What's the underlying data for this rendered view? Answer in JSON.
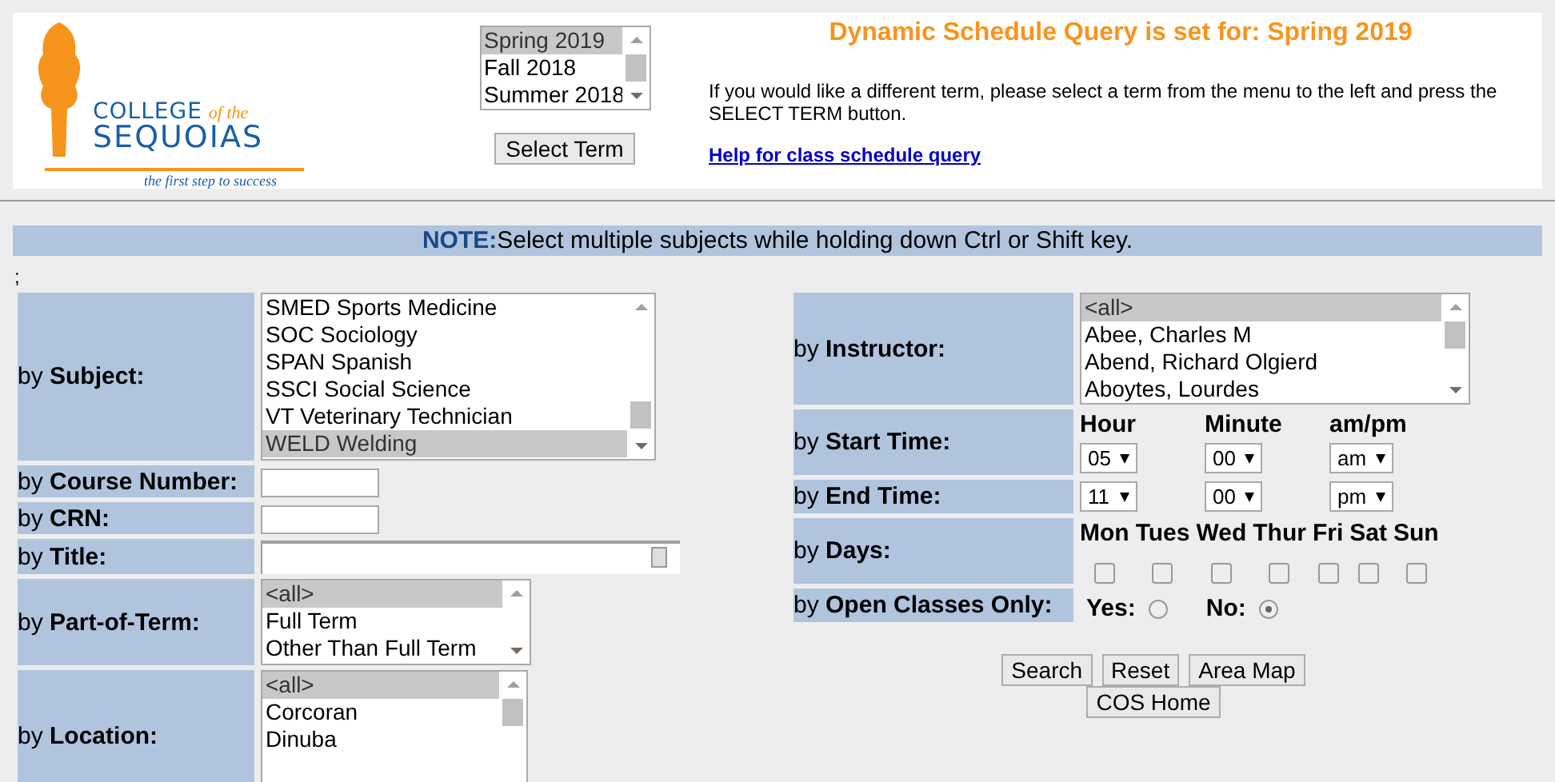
{
  "header": {
    "logo": {
      "line1": "COLLEGE",
      "of_the": "of the",
      "line2": "SEQUOIAS",
      "tagline": "the first step to success"
    },
    "term_list": [
      {
        "label": "Spring 2019",
        "selected": true
      },
      {
        "label": "Fall 2018",
        "selected": false
      },
      {
        "label": "Summer 2018",
        "selected": false
      }
    ],
    "select_button": "Select Term",
    "heading": "Dynamic Schedule Query is set for: Spring 2019",
    "instructions": "If you would like a different term, please select a term from the menu to the left and press the SELECT TERM button.",
    "help_link": "Help for class schedule query"
  },
  "note": {
    "label": "NOTE:",
    "text": "Select multiple subjects while holding down Ctrl or Shift key."
  },
  "separator": ";",
  "left_filters": [
    {
      "kind": "listbox",
      "label": "by **Subject:**",
      "options": [
        {
          "label": "SMED Sports Medicine",
          "selected": false
        },
        {
          "label": "SOC Sociology",
          "selected": false
        },
        {
          "label": "SPAN Spanish",
          "selected": false
        },
        {
          "label": "SSCI Social Science",
          "selected": false
        },
        {
          "label": "VT Veterinary Technician",
          "selected": false
        },
        {
          "label": "WELD Welding",
          "selected": true
        }
      ]
    },
    {
      "kind": "text",
      "label": "by **Course Number:**"
    },
    {
      "kind": "text",
      "label": "by **CRN:**"
    },
    {
      "kind": "wide-text",
      "label": "by **Title:**"
    },
    {
      "kind": "listbox",
      "label": "by **Part-of-Term:**",
      "options": [
        {
          "label": "<all>",
          "selected": true
        },
        {
          "label": "Full Term",
          "selected": false
        },
        {
          "label": "Other Than Full Term",
          "selected": false
        }
      ]
    },
    {
      "kind": "listbox",
      "label": "by **Location:**",
      "options": [
        {
          "label": "<all>",
          "selected": true
        },
        {
          "label": "Corcoran",
          "selected": false
        },
        {
          "label": "Dinuba",
          "selected": false
        }
      ]
    }
  ],
  "right_filters": [
    {
      "kind": "listbox",
      "label": "by **Instructor:**",
      "options": [
        {
          "label": "<all>",
          "selected": true
        },
        {
          "label": "Abee, Charles M",
          "selected": false
        },
        {
          "label": "Abend, Richard Olgierd",
          "selected": false
        },
        {
          "label": "Aboytes, Lourdes",
          "selected": false
        }
      ]
    },
    {
      "kind": "time",
      "label": "by **Start Time:**",
      "headers": [
        "Hour",
        "Minute",
        "am/pm"
      ],
      "values": [
        "05",
        "00",
        "am"
      ]
    },
    {
      "kind": "time",
      "label": "by **End Time:**",
      "values": [
        "11",
        "00",
        "pm"
      ]
    },
    {
      "kind": "days",
      "label": "by **Days:**",
      "days": [
        {
          "label": "Mon",
          "checked": false
        },
        {
          "label": "Tues",
          "checked": false
        },
        {
          "label": "Wed",
          "checked": false
        },
        {
          "label": "Thur",
          "checked": false
        },
        {
          "label": "Fri",
          "checked": false
        },
        {
          "label": "Sat",
          "checked": false
        },
        {
          "label": "Sun",
          "checked": false
        }
      ]
    },
    {
      "kind": "radio",
      "label": "by **Open Classes Only:**",
      "options": [
        {
          "label": "Yes:",
          "selected": false
        },
        {
          "label": "No:",
          "selected": true
        }
      ]
    }
  ],
  "buttons": [
    "Search",
    "Reset",
    "Area Map",
    "COS Home"
  ]
}
